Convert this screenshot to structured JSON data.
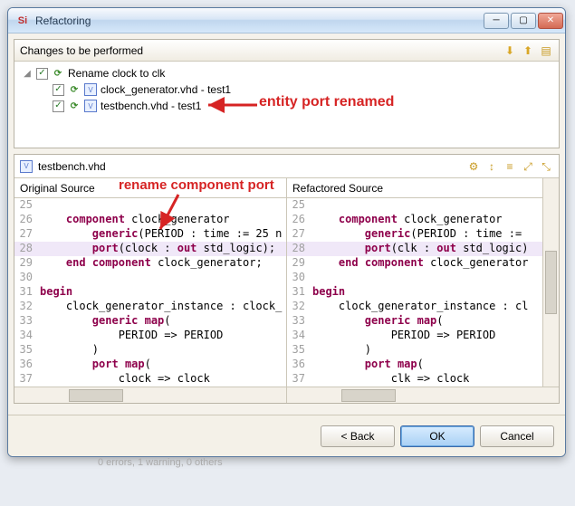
{
  "window": {
    "title": "Refactoring"
  },
  "changes": {
    "header": "Changes to be performed",
    "root": "Rename clock to clk",
    "items": [
      "clock_generator.vhd - test1",
      "testbench.vhd - test1"
    ]
  },
  "annotations": {
    "entity_renamed": "entity port renamed",
    "rename_component": "rename component port"
  },
  "diff": {
    "file": "testbench.vhd",
    "left_title": "Original Source",
    "right_title": "Refactored Source",
    "left_lines": [
      {
        "n": 25,
        "t": ""
      },
      {
        "n": 26,
        "t": "    component clock_generator"
      },
      {
        "n": 27,
        "t": "        generic(PERIOD : time := 25 n"
      },
      {
        "n": 28,
        "t": "        port(clock : out std_logic);",
        "hl": true
      },
      {
        "n": 29,
        "t": "    end component clock_generator;"
      },
      {
        "n": 30,
        "t": ""
      },
      {
        "n": 31,
        "t": "begin"
      },
      {
        "n": 32,
        "t": "    clock_generator_instance : clock_"
      },
      {
        "n": 33,
        "t": "        generic map("
      },
      {
        "n": 34,
        "t": "            PERIOD => PERIOD"
      },
      {
        "n": 35,
        "t": "        )"
      },
      {
        "n": 36,
        "t": "        port map("
      },
      {
        "n": 37,
        "t": "            clock => clock"
      }
    ],
    "right_lines": [
      {
        "n": 25,
        "t": ""
      },
      {
        "n": 26,
        "t": "    component clock_generator"
      },
      {
        "n": 27,
        "t": "        generic(PERIOD : time :="
      },
      {
        "n": 28,
        "t": "        port(clk : out std_logic)",
        "hl": true
      },
      {
        "n": 29,
        "t": "    end component clock_generator"
      },
      {
        "n": 30,
        "t": ""
      },
      {
        "n": 31,
        "t": "begin"
      },
      {
        "n": 32,
        "t": "    clock_generator_instance : cl"
      },
      {
        "n": 33,
        "t": "        generic map("
      },
      {
        "n": 34,
        "t": "            PERIOD => PERIOD"
      },
      {
        "n": 35,
        "t": "        )"
      },
      {
        "n": 36,
        "t": "        port map("
      },
      {
        "n": 37,
        "t": "            clk => clock"
      }
    ]
  },
  "buttons": {
    "back": "< Back",
    "ok": "OK",
    "cancel": "Cancel"
  },
  "status": "0 errors, 1 warning, 0 others"
}
